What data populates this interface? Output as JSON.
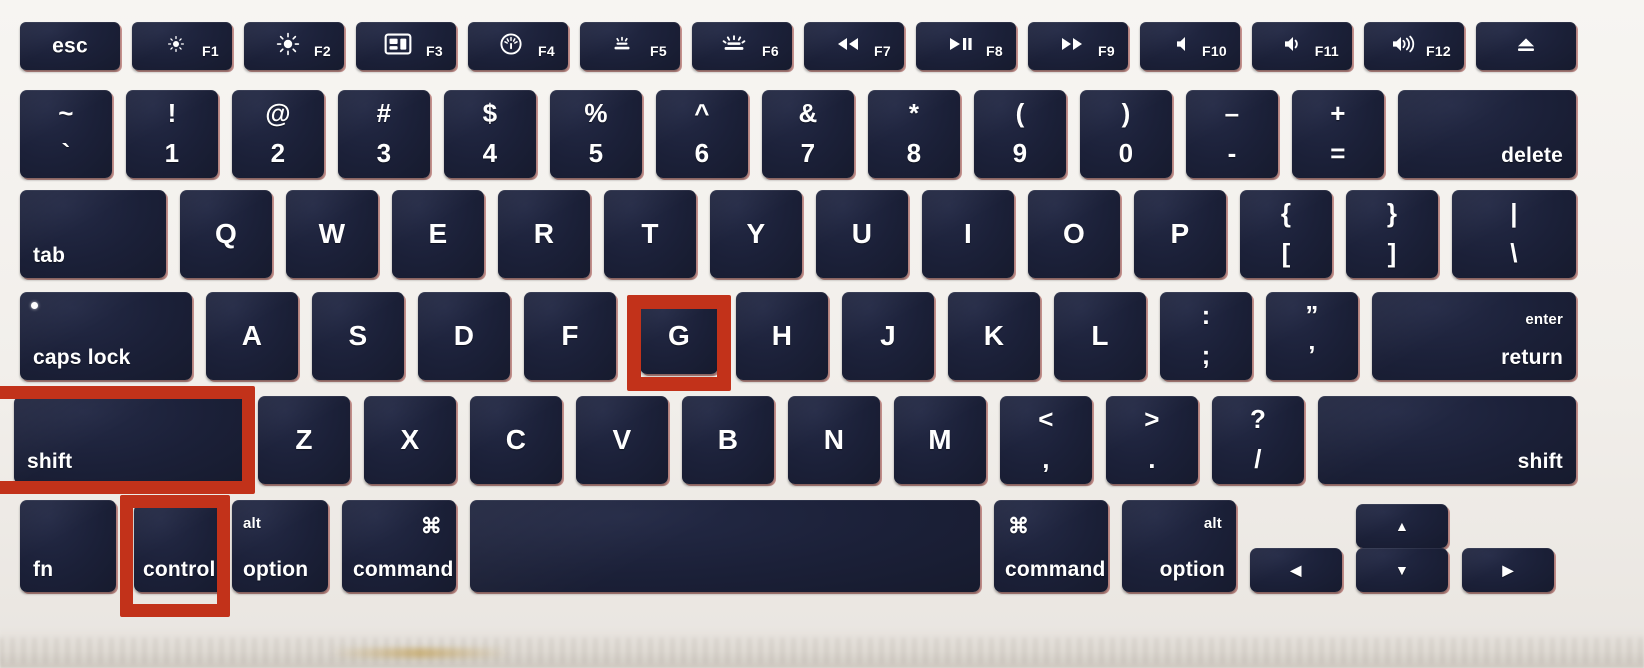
{
  "device": {
    "name": "MacBook keyboard",
    "key_color": "#1b2038",
    "base_color": "#f2efeb",
    "highlight_color": "#c2321a",
    "label_color": "#ffffff"
  },
  "highlights": [
    {
      "name": "g-key-highlight",
      "target": "G"
    },
    {
      "name": "shift-key-highlight",
      "target": "shift"
    },
    {
      "name": "control-key-highlight",
      "target": "control"
    }
  ],
  "rows": {
    "function_row": [
      {
        "id": "esc",
        "primary": "esc",
        "fn": "",
        "icon": ""
      },
      {
        "id": "f1",
        "primary": "",
        "fn": "F1",
        "icon": "brightness-down-icon"
      },
      {
        "id": "f2",
        "primary": "",
        "fn": "F2",
        "icon": "brightness-up-icon"
      },
      {
        "id": "f3",
        "primary": "",
        "fn": "F3",
        "icon": "mission-control-icon"
      },
      {
        "id": "f4",
        "primary": "",
        "fn": "F4",
        "icon": "launchpad-icon"
      },
      {
        "id": "f5",
        "primary": "",
        "fn": "F5",
        "icon": "keyboard-backlight-down-icon"
      },
      {
        "id": "f6",
        "primary": "",
        "fn": "F6",
        "icon": "keyboard-backlight-up-icon"
      },
      {
        "id": "f7",
        "primary": "",
        "fn": "F7",
        "icon": "rewind-icon"
      },
      {
        "id": "f8",
        "primary": "",
        "fn": "F8",
        "icon": "play-pause-icon"
      },
      {
        "id": "f9",
        "primary": "",
        "fn": "F9",
        "icon": "fast-forward-icon"
      },
      {
        "id": "f10",
        "primary": "",
        "fn": "F10",
        "icon": "mute-icon"
      },
      {
        "id": "f11",
        "primary": "",
        "fn": "F11",
        "icon": "volume-down-icon"
      },
      {
        "id": "f12",
        "primary": "",
        "fn": "F12",
        "icon": "volume-up-icon"
      },
      {
        "id": "eject",
        "primary": "",
        "fn": "",
        "icon": "eject-icon"
      }
    ],
    "number_row": [
      {
        "id": "grave",
        "upper": "~",
        "lower": "`"
      },
      {
        "id": "one",
        "upper": "!",
        "lower": "1"
      },
      {
        "id": "two",
        "upper": "@",
        "lower": "2"
      },
      {
        "id": "three",
        "upper": "#",
        "lower": "3"
      },
      {
        "id": "four",
        "upper": "$",
        "lower": "4"
      },
      {
        "id": "five",
        "upper": "%",
        "lower": "5"
      },
      {
        "id": "six",
        "upper": "^",
        "lower": "6"
      },
      {
        "id": "seven",
        "upper": "&",
        "lower": "7"
      },
      {
        "id": "eight",
        "upper": "*",
        "lower": "8"
      },
      {
        "id": "nine",
        "upper": "(",
        "lower": "9"
      },
      {
        "id": "zero",
        "upper": ")",
        "lower": "0"
      },
      {
        "id": "minus",
        "upper": "–",
        "lower": "-"
      },
      {
        "id": "equal",
        "upper": "+",
        "lower": "="
      },
      {
        "id": "delete",
        "label": "delete"
      }
    ],
    "top_row": [
      {
        "id": "tab",
        "label": "tab"
      },
      {
        "id": "q",
        "label": "Q"
      },
      {
        "id": "w",
        "label": "W"
      },
      {
        "id": "e",
        "label": "E"
      },
      {
        "id": "r",
        "label": "R"
      },
      {
        "id": "t",
        "label": "T"
      },
      {
        "id": "y",
        "label": "Y"
      },
      {
        "id": "u",
        "label": "U"
      },
      {
        "id": "i",
        "label": "I"
      },
      {
        "id": "o",
        "label": "O"
      },
      {
        "id": "p",
        "label": "P"
      },
      {
        "id": "bracketleft",
        "upper": "{",
        "lower": "["
      },
      {
        "id": "bracketright",
        "upper": "}",
        "lower": "]"
      },
      {
        "id": "backslash",
        "upper": "|",
        "lower": "\\"
      }
    ],
    "home_row": [
      {
        "id": "capslock",
        "label": "caps lock"
      },
      {
        "id": "a",
        "label": "A"
      },
      {
        "id": "s",
        "label": "S"
      },
      {
        "id": "d",
        "label": "D"
      },
      {
        "id": "f",
        "label": "F"
      },
      {
        "id": "g",
        "label": "G"
      },
      {
        "id": "h",
        "label": "H"
      },
      {
        "id": "j",
        "label": "J"
      },
      {
        "id": "k",
        "label": "K"
      },
      {
        "id": "l",
        "label": "L"
      },
      {
        "id": "semicolon",
        "upper": ":",
        "lower": ";"
      },
      {
        "id": "quote",
        "upper": "”",
        "lower": "’"
      },
      {
        "id": "return",
        "upper": "enter",
        "lower": "return"
      }
    ],
    "bottom_letter_row": [
      {
        "id": "shift_left",
        "label": "shift"
      },
      {
        "id": "z",
        "label": "Z"
      },
      {
        "id": "x",
        "label": "X"
      },
      {
        "id": "c",
        "label": "C"
      },
      {
        "id": "v",
        "label": "V"
      },
      {
        "id": "b",
        "label": "B"
      },
      {
        "id": "n",
        "label": "N"
      },
      {
        "id": "m",
        "label": "M"
      },
      {
        "id": "comma",
        "upper": "<",
        "lower": ","
      },
      {
        "id": "period",
        "upper": ">",
        "lower": "."
      },
      {
        "id": "slash",
        "upper": "?",
        "lower": "/"
      },
      {
        "id": "shift_right",
        "label": "shift"
      }
    ],
    "modifier_row": [
      {
        "id": "fn",
        "label": "fn"
      },
      {
        "id": "control",
        "label": "control"
      },
      {
        "id": "option_left",
        "upper": "alt",
        "lower": "option",
        "align": "left"
      },
      {
        "id": "command_left",
        "upper": "⌘",
        "lower": "command",
        "align": "cmd-left"
      },
      {
        "id": "space",
        "label": ""
      },
      {
        "id": "command_right",
        "upper": "⌘",
        "lower": "command",
        "align": "left"
      },
      {
        "id": "option_right",
        "upper": "alt",
        "lower": "option",
        "align": "right"
      }
    ],
    "arrow_cluster": [
      {
        "id": "arrow_left",
        "icon": "arrow-left-icon",
        "glyph": "◀"
      },
      {
        "id": "arrow_up",
        "icon": "arrow-up-icon",
        "glyph": "▲"
      },
      {
        "id": "arrow_down",
        "icon": "arrow-down-icon",
        "glyph": "▼"
      },
      {
        "id": "arrow_right",
        "icon": "arrow-right-icon",
        "glyph": "▶"
      }
    ]
  }
}
